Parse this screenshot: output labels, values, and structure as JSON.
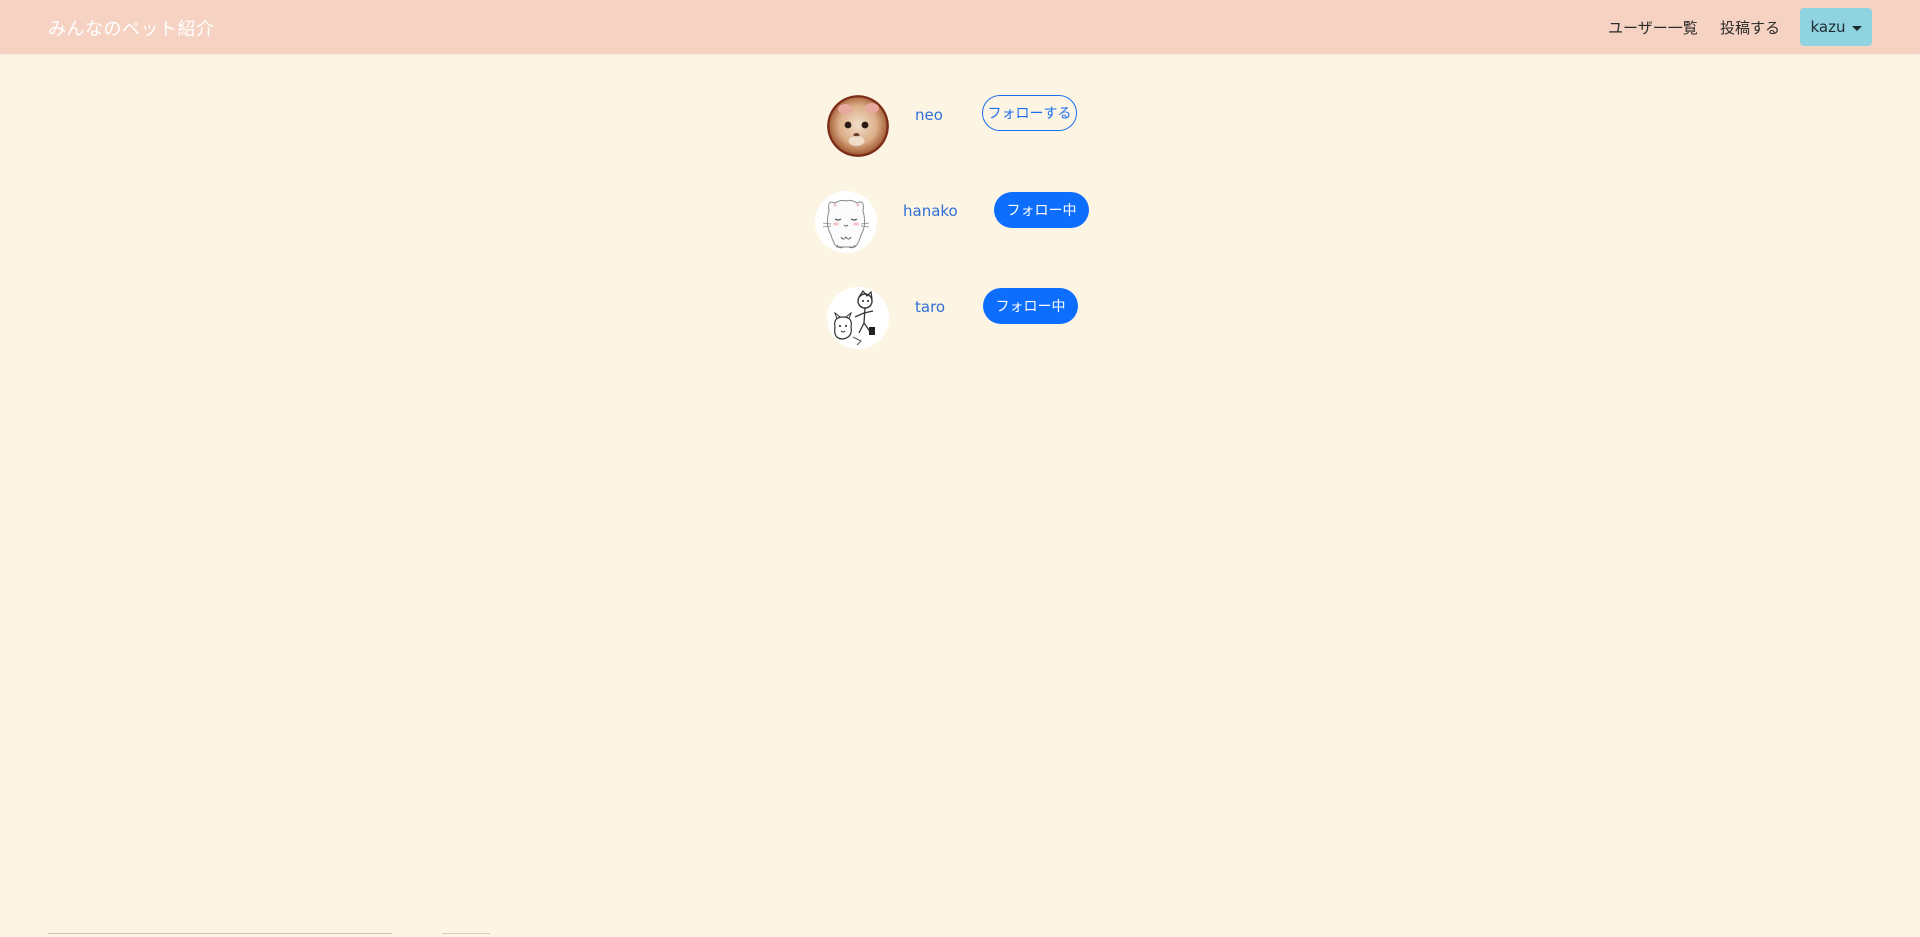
{
  "navbar": {
    "brand": "みんなのペット紹介",
    "links": {
      "users": "ユーザー一覧",
      "post": "投稿する"
    },
    "user_menu": {
      "label": "kazu",
      "icon": "caret-down-icon"
    },
    "colors": {
      "background": "#f5d2c1",
      "dropdown": "#8fd3e0"
    }
  },
  "page": {
    "background": "#fdf5e4"
  },
  "users": [
    {
      "name": "neo",
      "avatar": "hamster-photo-avatar",
      "follow_label": "フォローする",
      "following": false
    },
    {
      "name": "hanako",
      "avatar": "white-cat-illustration-avatar",
      "follow_label": "フォロー中",
      "following": true
    },
    {
      "name": "taro",
      "avatar": "sketch-illustration-avatar",
      "follow_label": "フォロー中",
      "following": true
    }
  ],
  "colors": {
    "link": "#2f6fd6",
    "primary": "#0d6efd"
  }
}
